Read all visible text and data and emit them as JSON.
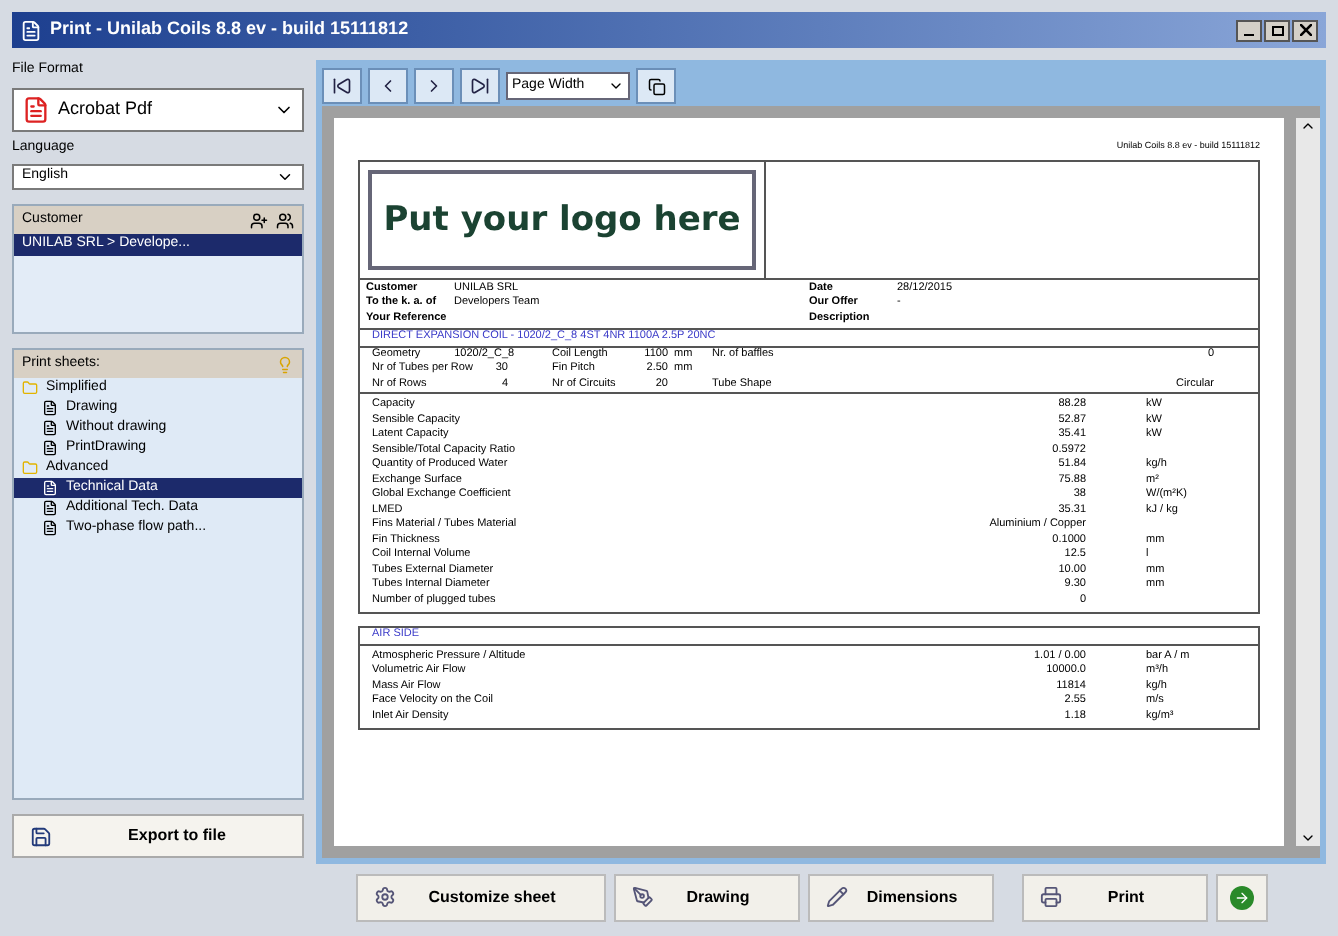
{
  "window": {
    "title": "Print - Unilab Coils 8.8 ev - build 15111812"
  },
  "sidebar": {
    "file_format": {
      "label": "File Format",
      "value": "Acrobat Pdf"
    },
    "language": {
      "label": "Language",
      "value": "English"
    },
    "customer": {
      "title": "Customer",
      "items": [
        {
          "label": "UNILAB SRL > Develope...",
          "selected": true
        }
      ]
    },
    "print_sheets": {
      "title": "Print sheets:",
      "tree": [
        {
          "label": "Simplified",
          "children": [
            {
              "label": "Drawing",
              "selected": false
            },
            {
              "label": "Without drawing",
              "selected": false
            },
            {
              "label": "PrintDrawing",
              "selected": false
            }
          ]
        },
        {
          "label": "Advanced",
          "children": [
            {
              "label": "Technical Data",
              "selected": true
            },
            {
              "label": "Additional Tech. Data",
              "selected": false
            },
            {
              "label": "Two-phase flow path...",
              "selected": false
            }
          ]
        }
      ]
    },
    "export_button": "Export to file"
  },
  "toolbar": {
    "zoom": "Page Width"
  },
  "document": {
    "header": "Unilab Coils 8.8 ev - build 15111812",
    "logo": "Put your logo here",
    "info": [
      [
        {
          "label": "Customer",
          "value": "UNILAB SRL"
        },
        {
          "label": "Date",
          "value": "28/12/2015"
        }
      ],
      [
        {
          "label": "To the k. a. of",
          "value": "Developers Team"
        },
        {
          "label": "Our Offer",
          "value": "-"
        }
      ],
      [
        {
          "label": "Your Reference"
        },
        {
          "label": "Description"
        }
      ]
    ],
    "title": "DIRECT EXPANSION COIL - 1020/2_C_8 4ST 4NR 1100A 2.5P 20NC",
    "geometry": [
      [
        {
          "label": "Geometry",
          "value": "1020/2_C_8"
        },
        {
          "label": "Coil Length",
          "value": "1100",
          "unit": "mm"
        },
        {
          "label": "Nr. of baffles",
          "value": "0"
        }
      ],
      [
        {
          "label": "Nr of Tubes per Row",
          "value": "30"
        },
        {
          "label": "Fin Pitch",
          "value": "2.50",
          "unit": "mm"
        }
      ],
      [
        {
          "label": "Nr of Rows",
          "value": "4"
        },
        {
          "label": "Nr of Circuits",
          "value": "20"
        },
        {
          "label": "Tube Shape",
          "value": "Circular"
        }
      ]
    ],
    "rows": [
      {
        "label": "Capacity",
        "value": "88.28",
        "unit": "kW"
      },
      {
        "label": "Sensible Capacity",
        "value": "52.87",
        "unit": "kW"
      },
      {
        "label": "Latent Capacity",
        "value": "35.41",
        "unit": "kW"
      },
      {
        "label": "Sensible/Total Capacity Ratio",
        "value": "0.5972"
      },
      {
        "label": "Quantity of Produced Water",
        "value": "51.84",
        "unit": "kg/h"
      },
      {
        "label": "Exchange Surface",
        "value": "75.88",
        "unit": "m²"
      },
      {
        "label": "Global Exchange Coefficient",
        "value": "38",
        "unit": "W/(m²K)"
      },
      {
        "label": "LMED",
        "value": "35.31",
        "unit": "kJ / kg"
      },
      {
        "label": "Fins Material / Tubes Material",
        "value": "Aluminium / Copper"
      },
      {
        "label": "Fin Thickness",
        "value": "0.1000",
        "unit": "mm"
      },
      {
        "label": "Coil Internal Volume",
        "value": "12.5",
        "unit": "l"
      },
      {
        "label": "Tubes External Diameter",
        "value": "10.00",
        "unit": "mm"
      },
      {
        "label": "Tubes Internal Diameter",
        "value": "9.30",
        "unit": "mm"
      },
      {
        "label": "Number of plugged tubes",
        "value": "0"
      }
    ],
    "air_title": "AIR SIDE",
    "air_rows": [
      {
        "label": "Atmospheric Pressure / Altitude",
        "value": "1.01 / 0.00",
        "unit": "bar A / m"
      },
      {
        "label": "Volumetric Air Flow",
        "value": "10000.0",
        "unit": "m³/h"
      },
      {
        "label": "Mass Air Flow",
        "value": "11814",
        "unit": "kg/h"
      },
      {
        "label": "Face Velocity on the Coil",
        "value": "2.55",
        "unit": "m/s"
      },
      {
        "label": "Inlet Air Density",
        "value": "1.18",
        "unit": "kg/m³"
      }
    ]
  },
  "footer": [
    "Customize sheet",
    "Drawing",
    "Dimensions",
    "Print"
  ]
}
